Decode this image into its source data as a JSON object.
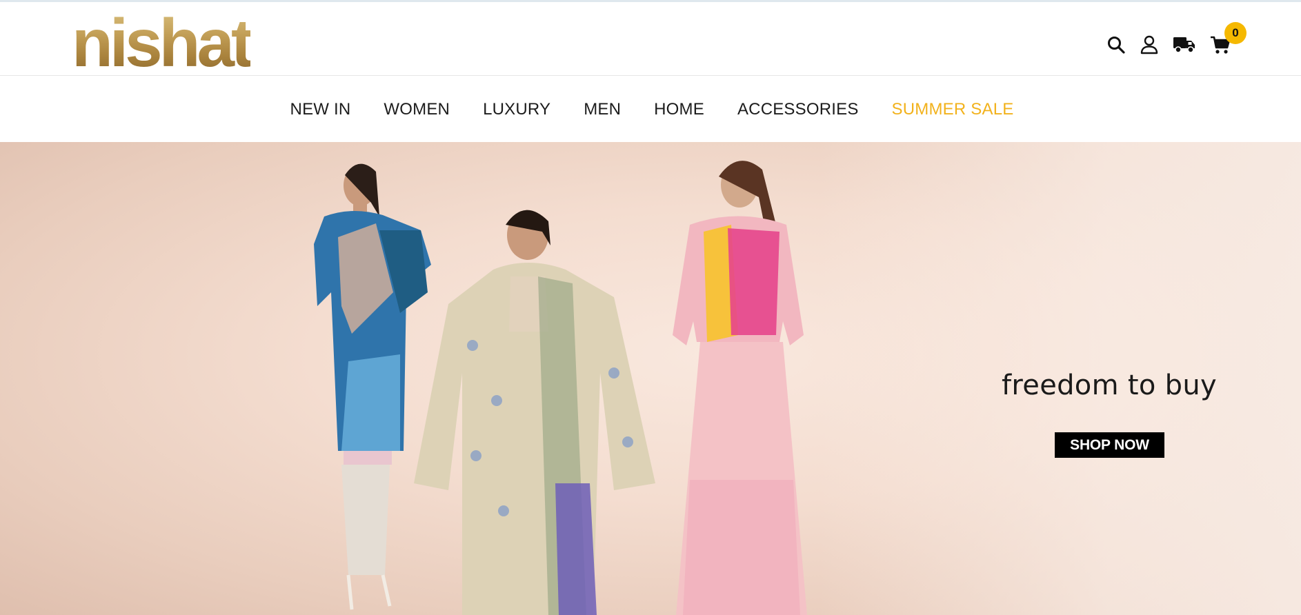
{
  "brand": {
    "logo_text": "nishat",
    "accent_gold": "#b08d47",
    "sale_color": "#f2b21c",
    "badge_color": "#f5b800"
  },
  "header": {
    "icons": [
      "search-icon",
      "user-icon",
      "delivery-truck-icon",
      "cart-icon"
    ],
    "cart_count": "0"
  },
  "nav": {
    "items": [
      {
        "label": "NEW IN"
      },
      {
        "label": "WOMEN"
      },
      {
        "label": "LUXURY"
      },
      {
        "label": "MEN"
      },
      {
        "label": "HOME"
      },
      {
        "label": "ACCESSORIES"
      },
      {
        "label": "SUMMER SALE"
      }
    ]
  },
  "hero": {
    "tagline": "freedom to buy",
    "cta_label": "SHOP NOW"
  }
}
